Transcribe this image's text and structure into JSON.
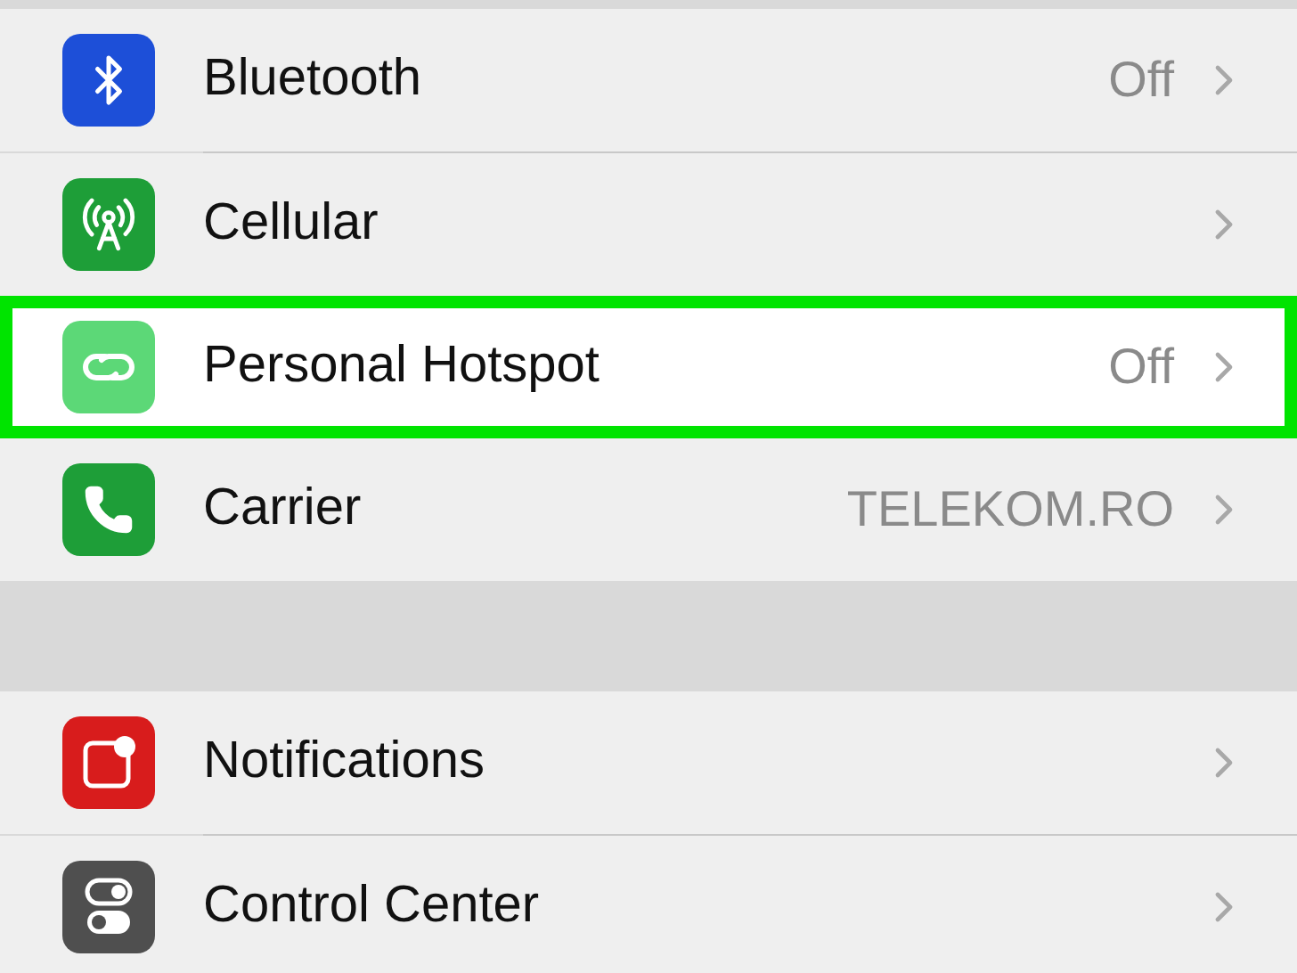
{
  "groups": [
    {
      "rows": [
        {
          "kind": "bluetooth",
          "label": "Bluetooth",
          "value": "Off",
          "color": "#1d4fd8",
          "highlighted": false
        },
        {
          "kind": "cellular",
          "label": "Cellular",
          "color": "#1e9e38",
          "highlighted": false
        },
        {
          "kind": "hotspot",
          "label": "Personal Hotspot",
          "value": "Off",
          "color": "#5cd877",
          "highlighted": true
        },
        {
          "kind": "carrier",
          "label": "Carrier",
          "value": "TELEKOM.RO",
          "color": "#1e9e38",
          "highlighted": false
        }
      ]
    },
    {
      "rows": [
        {
          "kind": "notifications",
          "label": "Notifications",
          "color": "#d81c1c",
          "highlighted": false
        },
        {
          "kind": "control",
          "label": "Control Center",
          "color": "#4f4f4f",
          "highlighted": false
        }
      ]
    }
  ]
}
